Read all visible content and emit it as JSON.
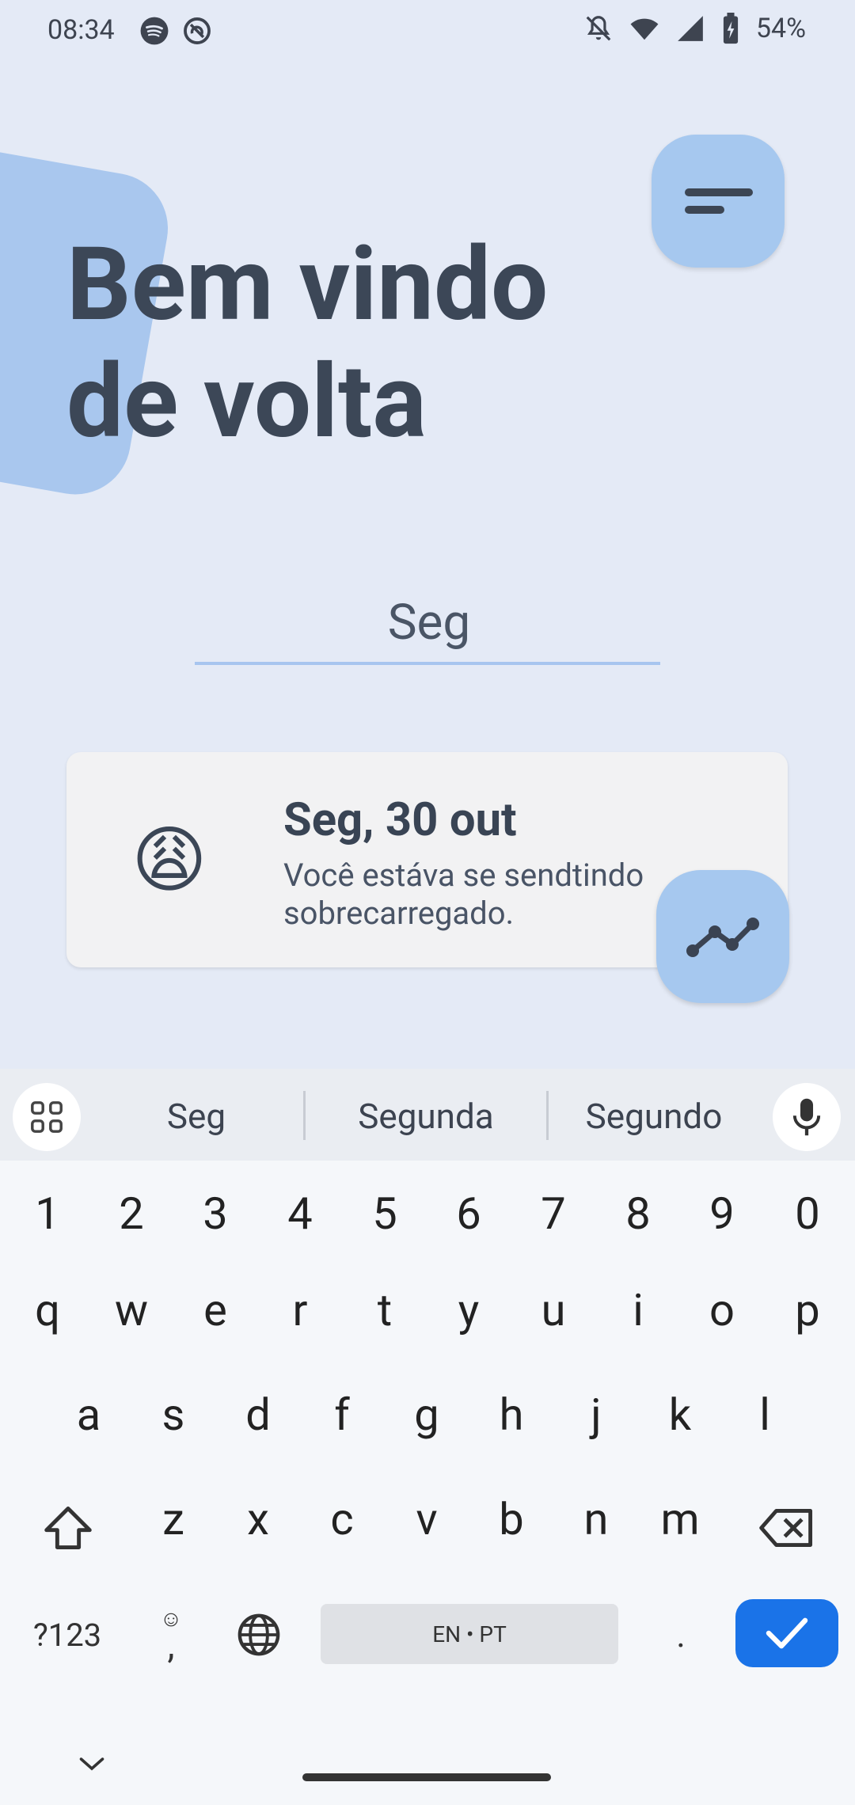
{
  "status_bar": {
    "time": "08:34",
    "left_icons": [
      "spotify-icon",
      "sync-icon"
    ],
    "right_icons": [
      "notifications-off-icon",
      "wifi-icon",
      "signal-icon",
      "battery-charging-icon"
    ],
    "battery": "54%"
  },
  "header": {
    "title_line1": "Bem vindo",
    "title_line2": "de volta",
    "menu_icon": "menu-icon"
  },
  "search": {
    "value": "Seg"
  },
  "entry": {
    "emoji": "😩",
    "date": "Seg, 30 out",
    "text": "Você estáva se sendtindo sobrecarregado.",
    "chart_icon": "trend-chart-icon"
  },
  "keyboard": {
    "suggestions": [
      "Seg",
      "Segunda",
      "Segundo"
    ],
    "number_row": [
      "1",
      "2",
      "3",
      "4",
      "5",
      "6",
      "7",
      "8",
      "9",
      "0"
    ],
    "row1": [
      "q",
      "w",
      "e",
      "r",
      "t",
      "y",
      "u",
      "i",
      "o",
      "p"
    ],
    "row2": [
      "a",
      "s",
      "d",
      "f",
      "g",
      "h",
      "j",
      "k",
      "l"
    ],
    "row3": [
      "z",
      "x",
      "c",
      "v",
      "b",
      "n",
      "m"
    ],
    "symbols_label": "?123",
    "emoji_comma": ",",
    "space_label": "EN • PT",
    "period": ".",
    "colors": {
      "accent": "#1a73e8",
      "fab": "#a6c8ef",
      "background": "#e4eaf6"
    }
  }
}
